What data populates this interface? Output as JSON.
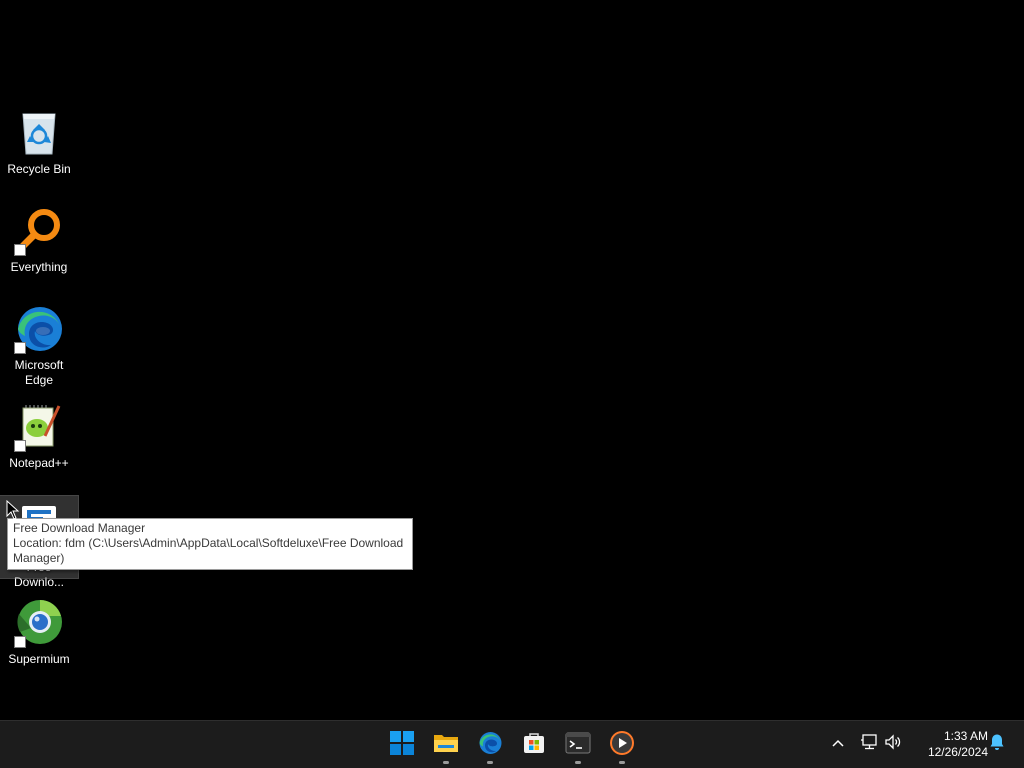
{
  "desktop": {
    "icons": [
      {
        "label": "Recycle Bin",
        "icon": "recycle-bin-icon"
      },
      {
        "label": "Everything",
        "icon": "everything-search-icon"
      },
      {
        "label": "Microsoft Edge",
        "icon": "edge-icon"
      },
      {
        "label": "Notepad++",
        "icon": "notepad-plus-plus-icon"
      },
      {
        "label": "Free Downlo...",
        "icon": "free-download-manager-icon"
      },
      {
        "label": "Supermium",
        "icon": "supermium-icon"
      }
    ],
    "tooltip": {
      "title": "Free Download Manager",
      "location": "Location: fdm (C:\\Users\\Admin\\AppData\\Local\\Softdeluxe\\Free Download Manager)"
    }
  },
  "taskbar": {
    "apps": [
      {
        "name": "Start",
        "icon": "windows-start-icon"
      },
      {
        "name": "File Explorer",
        "icon": "file-explorer-icon"
      },
      {
        "name": "Microsoft Edge",
        "icon": "edge-icon"
      },
      {
        "name": "Microsoft Store",
        "icon": "store-icon"
      },
      {
        "name": "Terminal",
        "icon": "terminal-icon"
      },
      {
        "name": "Media Player",
        "icon": "media-player-icon"
      }
    ],
    "tray": {
      "chevron": "chevron-up-icon",
      "network": "network-icon",
      "volume": "volume-icon",
      "notifications": "bell-icon"
    },
    "clock": {
      "time": "1:33 AM",
      "date": "12/26/2024"
    }
  },
  "colors": {
    "desktop_background": "#000000",
    "taskbar_background": "#1c1c1c",
    "accent": "#0078d4",
    "notification_bell": "#4cc2ff"
  }
}
